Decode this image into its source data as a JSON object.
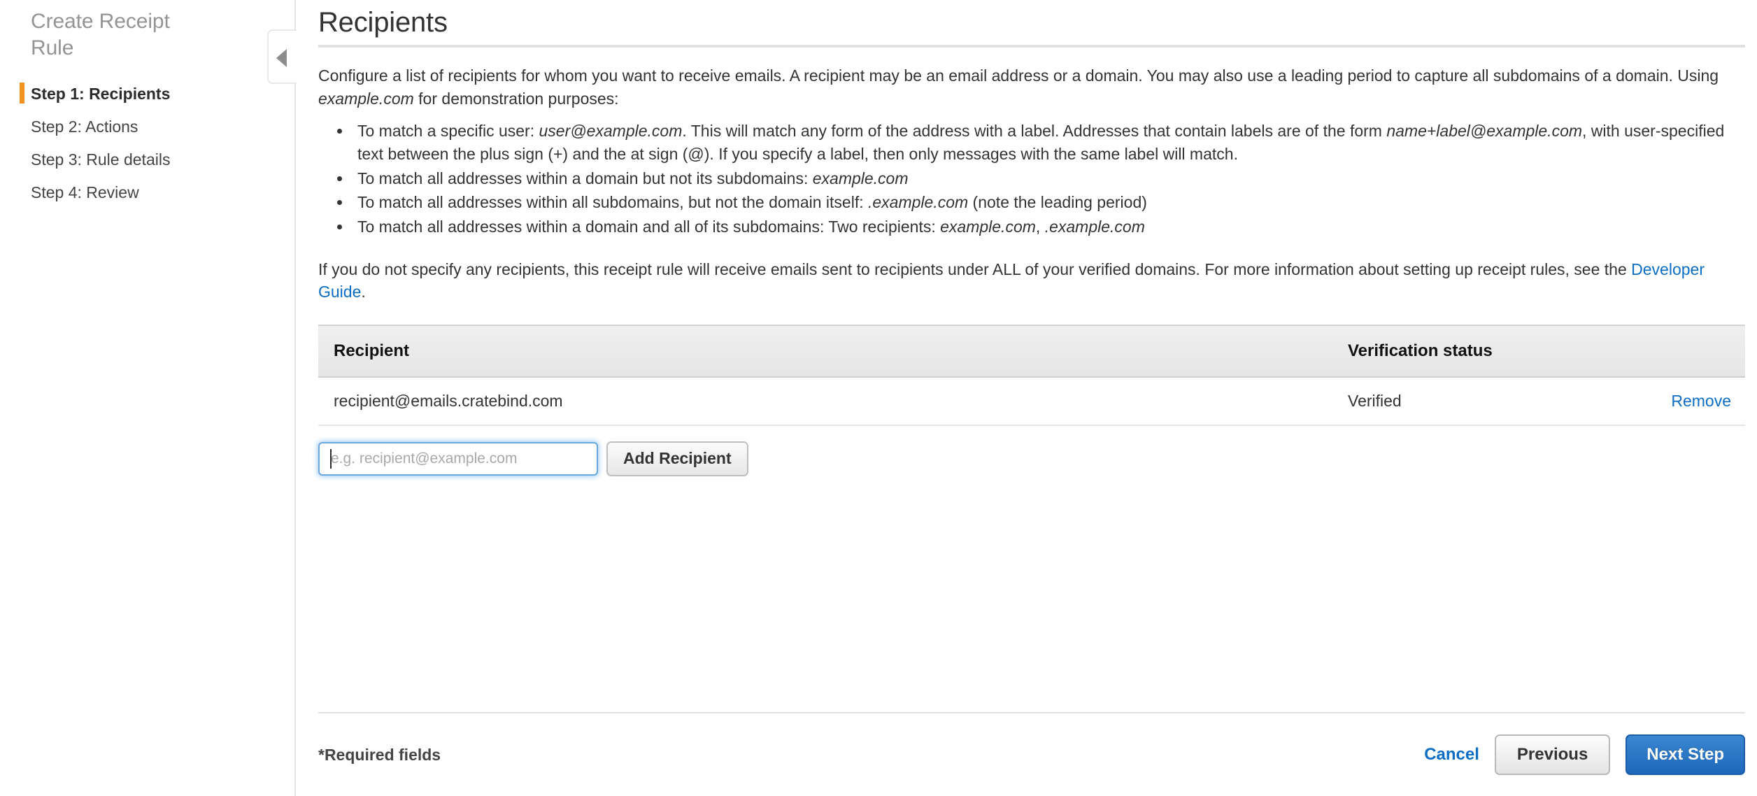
{
  "sidebar": {
    "wizard_title": "Create Receipt Rule",
    "steps": [
      {
        "label": "Step 1: Recipients",
        "active": true
      },
      {
        "label": "Step 2: Actions",
        "active": false
      },
      {
        "label": "Step 3: Rule details",
        "active": false
      },
      {
        "label": "Step 4: Review",
        "active": false
      }
    ],
    "collapse_icon": "triangle-left-icon",
    "active_marker_color": "#f29220"
  },
  "main": {
    "page_title": "Recipients",
    "intro_part1": "Configure a list of recipients for whom you want to receive emails. A recipient may be an email address or a domain. You may also use a leading period to capture all subdomains of a domain. Using ",
    "intro_example": "example.com",
    "intro_part2": " for demonstration purposes:",
    "bullets": [
      {
        "p1": "To match a specific user: ",
        "em1": "user@example.com",
        "p2": ". This will match any form of the address with a label. Addresses that contain labels are of the form ",
        "em2": "name+label@example.com",
        "p3": ", with user-specified text between the plus sign (+) and the at sign (@). If you specify a label, then only messages with the same label will match."
      },
      {
        "p1": "To match all addresses within a domain but not its subdomains: ",
        "em1": "example.com",
        "p2": "",
        "em2": "",
        "p3": ""
      },
      {
        "p1": "To match all addresses within all subdomains, but not the domain itself: ",
        "em1": ".example.com",
        "p2": " (note the leading period)",
        "em2": "",
        "p3": ""
      },
      {
        "p1": "To match all addresses within a domain and all of its subdomains: Two recipients: ",
        "em1": "example.com",
        "p2": ", ",
        "em2": ".example.com",
        "p3": ""
      }
    ],
    "note_part1": "If you do not specify any recipients, this receipt rule will receive emails sent to recipients under ALL of your verified domains. For more information about setting up receipt rules, see the ",
    "note_link": "Developer Guide",
    "note_part2": "."
  },
  "table": {
    "headers": {
      "recipient": "Recipient",
      "verification_status": "Verification status"
    },
    "rows": [
      {
        "recipient": "recipient@emails.cratebind.com",
        "status": "Verified",
        "action": "Remove"
      }
    ]
  },
  "add_recipient": {
    "input_value": "",
    "input_placeholder": "e.g. recipient@example.com",
    "button_label": "Add Recipient"
  },
  "footer": {
    "required_note": "*Required fields",
    "cancel_label": "Cancel",
    "previous_label": "Previous",
    "next_label": "Next Step",
    "next_color": "#2f7dc8",
    "link_color": "#0b6ec4"
  }
}
